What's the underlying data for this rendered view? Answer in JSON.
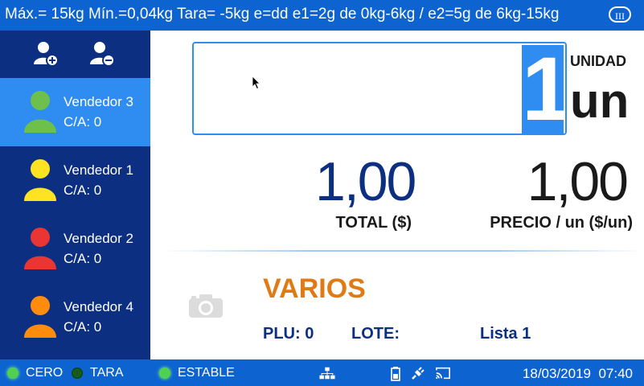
{
  "topbar": {
    "info": "Máx.= 15kg  Mín.=0,04kg  Tara= -5kg  e=dd  e1=2g de 0kg-6kg / e2=5g de 6kg-15kg",
    "class_badge": "III"
  },
  "sidebar": {
    "sellers": [
      {
        "name": "Vendedor 3",
        "ca": "C/A: 0",
        "color": "#6dc04b",
        "active": true
      },
      {
        "name": "Vendedor 1",
        "ca": "C/A: 0",
        "color": "#ffe323",
        "active": false
      },
      {
        "name": "Vendedor 2",
        "ca": "C/A: 0",
        "color": "#ea3535",
        "active": false
      },
      {
        "name": "Vendedor 4",
        "ca": "C/A: 0",
        "color": "#ff8c0d",
        "active": false
      }
    ]
  },
  "display": {
    "quantity": "1",
    "unit_label": "UNIDAD",
    "unit_value": "un"
  },
  "totals": {
    "total_value": "1,00",
    "total_label": "TOTAL ($)",
    "price_value": "1,00",
    "price_label": "PRECIO / un ($/un)"
  },
  "product": {
    "name": "VARIOS",
    "plu": "PLU: 0",
    "lote": "LOTE:",
    "lista": "Lista 1"
  },
  "status": {
    "cero": "CERO",
    "tara": "TARA",
    "estable": "ESTABLE",
    "date": "18/03/2019",
    "time": "07:40"
  },
  "colors": {
    "primary": "#0d63cf",
    "sidebar": "#0c2f82",
    "active": "#2f8cf0",
    "product": "#e07a14"
  }
}
